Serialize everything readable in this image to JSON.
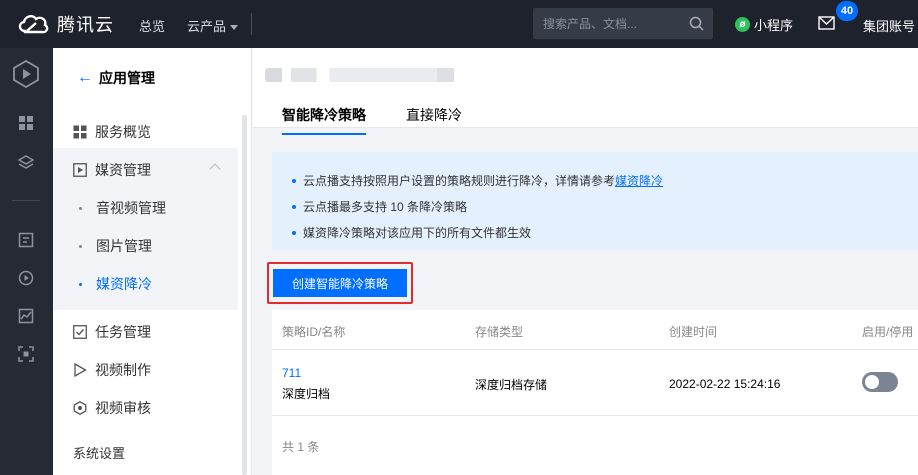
{
  "topbar": {
    "brand": "腾讯云",
    "nav": {
      "overview": "总览",
      "products": "云产品"
    },
    "search": {
      "placeholder": "搜索产品、文档..."
    },
    "mini_program": "小程序",
    "mail_badge": "40",
    "account": "集团账号"
  },
  "sidebar": {
    "back_label": "应用管理",
    "items": [
      {
        "label": "服务概览",
        "icon": "grid-icon"
      },
      {
        "label": "媒资管理",
        "icon": "play-square-icon"
      },
      {
        "label": "任务管理",
        "icon": "check-square-icon"
      },
      {
        "label": "视频制作",
        "icon": "play-triangle-icon"
      },
      {
        "label": "视频审核",
        "icon": "eye-check-icon"
      }
    ],
    "media_sub": [
      {
        "label": "音视频管理"
      },
      {
        "label": "图片管理"
      },
      {
        "label": "媒资降冷",
        "active": true
      }
    ],
    "system_settings": "系统设置"
  },
  "main": {
    "tabs": [
      {
        "label": "智能降冷策略",
        "active": true
      },
      {
        "label": "直接降冷",
        "active": false
      }
    ],
    "notice": {
      "line1_text": "云点播支持按照用户设置的策略规则进行降冷，详情请参考",
      "line1_link": "媒资降冷",
      "line2": "云点播最多支持 10 条降冷策略",
      "line3": "媒资降冷策略对该应用下的所有文件都生效"
    },
    "create_button": "创建智能降冷策略",
    "table": {
      "headers": [
        "策略ID/名称",
        "存储类型",
        "创建时间",
        "启用/停用"
      ],
      "rows": [
        {
          "id": "711",
          "name": "深度归档",
          "storage": "深度归档存储",
          "created": "2022-02-22 15:24:16",
          "enabled": false
        }
      ],
      "footer": "共 1 条"
    }
  },
  "colors": {
    "accent": "#006eff",
    "topbar": "#1e222d",
    "highlight": "#e12d2d"
  }
}
